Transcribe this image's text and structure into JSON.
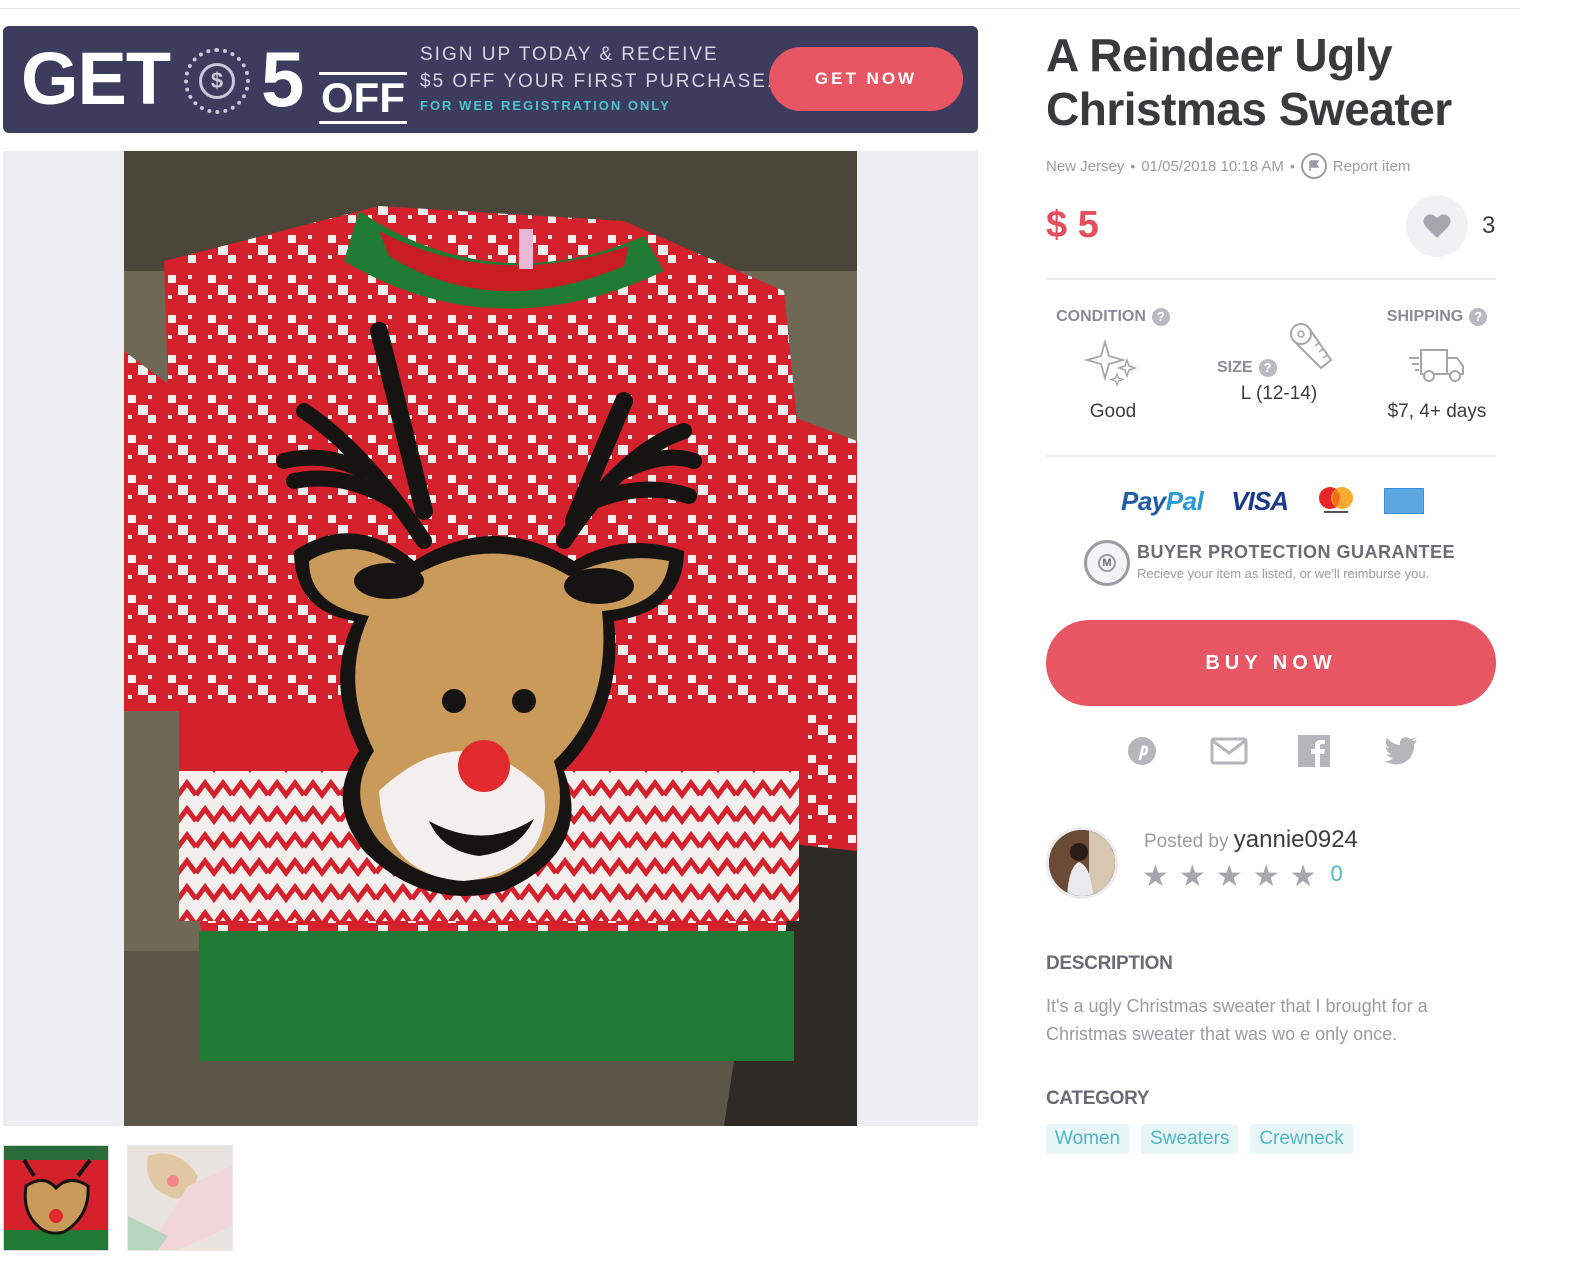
{
  "promo": {
    "get": "GET",
    "amount": "5",
    "off": "OFF",
    "currency_symbol": "$",
    "line1": "SIGN UP TODAY & RECEIVE",
    "line2": "$5 OFF YOUR FIRST PURCHASE.",
    "line3": "FOR WEB REGISTRATION ONLY",
    "button": "GET NOW",
    "colors": {
      "background": "#3e3c5e",
      "button": "#e85563",
      "accent": "#4cc6c9"
    }
  },
  "listing": {
    "title": "A Reindeer Ugly Christmas Sweater",
    "location": "New Jersey",
    "posted_at": "01/05/2018 10:18 AM",
    "report": "Report item",
    "price": "$ 5",
    "likes": "3",
    "condition": {
      "label": "CONDITION",
      "value": "Good",
      "icon": "sparkles-icon"
    },
    "size": {
      "label": "SIZE",
      "value": "L (12-14)",
      "icon": "measuring-tape-icon"
    },
    "shipping": {
      "label": "SHIPPING",
      "value": "$7, 4+ days",
      "icon": "truck-icon"
    },
    "help": "?"
  },
  "payments": {
    "paypal_a": "Pay",
    "paypal_b": "Pal",
    "visa": "VISA",
    "mastercard": "mastercard-logo",
    "amex": "amex-logo"
  },
  "guarantee": {
    "badge": "M",
    "title": "BUYER PROTECTION GUARANTEE",
    "subtitle": "Recieve your item as listed, or we'll reimburse you."
  },
  "buy_button": "BUY NOW",
  "share": [
    "pinterest-icon",
    "mail-icon",
    "facebook-icon",
    "twitter-icon"
  ],
  "seller": {
    "posted_by": "Posted by",
    "username": "yannie0924",
    "stars": 5,
    "star_glyph": "★",
    "rating_count": "0"
  },
  "description": {
    "heading": "DESCRIPTION",
    "text": "It's a ugly Christmas sweater that I brought for a Christmas sweater that was wo e only once."
  },
  "category": {
    "heading": "CATEGORY",
    "tags": [
      "Women",
      "Sweaters",
      "Crewneck"
    ]
  },
  "colors": {
    "price": "#e44f5d",
    "buy": "#e85563",
    "tag_text": "#4fb6c4",
    "tag_bg": "#e8f5f6"
  }
}
